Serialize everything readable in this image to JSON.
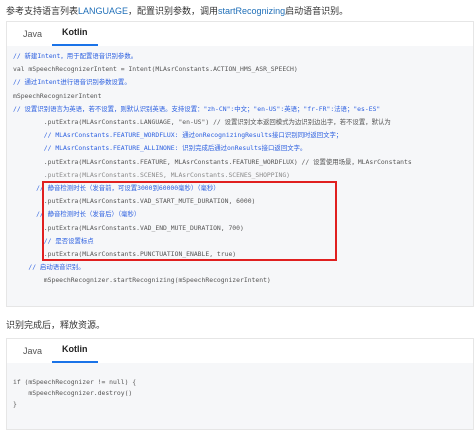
{
  "intro": {
    "text_before": "参考支持语言列表",
    "link1": "LANGUAGE",
    "text_mid": "，配置识别参数，调用",
    "link2": "startRecognizing",
    "text_after": "启动语音识别。"
  },
  "block1": {
    "tabs": [
      {
        "label": "Java",
        "active": false
      },
      {
        "label": "Kotlin",
        "active": true
      }
    ],
    "lines": [
      {
        "kind": "comment",
        "text": "// 新建Intent，用于配置语音识别参数。"
      },
      {
        "kind": "code",
        "text": "val mSpeechRecognizerIntent = Intent(MLAsrConstants.ACTION_HMS_ASR_SPEECH)"
      },
      {
        "kind": "comment",
        "text": "// 通过Intent进行语音识别参数设置。"
      },
      {
        "kind": "code",
        "text": "mSpeechRecognizerIntent"
      },
      {
        "kind": "comment",
        "text": "// 设置识别语言为英语，若不设置，则默认识别英语。支持设置：\"zh-CN\":中文；\"en-US\":英语；\"fr-FR\":法语；\"es-ES\""
      },
      {
        "kind": "code",
        "text": "        .putExtra(MLAsrConstants.LANGUAGE, \"en-US\") // 设置识别文本返回模式为边识别边出字，若不设置，默认为"
      },
      {
        "kind": "comment",
        "text": "        // MLAsrConstants.FEATURE_WORDFLUX: 通过onRecognizingResults接口识别同时返回文字；"
      },
      {
        "kind": "comment",
        "text": "        // MLAsrConstants.FEATURE_ALLINONE: 识别完成后通过onResults接口返回文字。"
      },
      {
        "kind": "code",
        "text": "        .putExtra(MLAsrConstants.FEATURE, MLAsrConstants.FEATURE_WORDFLUX) // 设置使用场景，MLAsrConstants"
      },
      {
        "kind": "dim",
        "text": "        .putExtra(MLAsrConstants.SCENES, MLAsrConstants.SCENES_SHOPPING)"
      },
      {
        "kind": "comment",
        "text": "      // 静音检测时长（发音前，可设置3000到60000毫秒）（毫秒）"
      },
      {
        "kind": "code",
        "text": "        .putExtra(MLAsrConstants.VAD_START_MUTE_DURATION, 6000)"
      },
      {
        "kind": "comment",
        "text": "      // 静音检测时长（发音后）（毫秒）"
      },
      {
        "kind": "code",
        "text": "        .putExtra(MLAsrConstants.VAD_END_MUTE_DURATION, 700)"
      },
      {
        "kind": "comment",
        "text": "        // 是否设置标点"
      },
      {
        "kind": "code",
        "text": "        .putExtra(MLAsrConstants.PUNCTUATION_ENABLE, true)"
      },
      {
        "kind": "comment",
        "text": "    // 启动语音识别。"
      },
      {
        "kind": "code",
        "text": "        mSpeechRecognizer.startRecognizing(mSpeechRecognizerIntent)"
      }
    ]
  },
  "separator_text": "识别完成后，释放资源。",
  "block2": {
    "tabs": [
      {
        "label": "Java",
        "active": false
      },
      {
        "label": "Kotlin",
        "active": true
      }
    ],
    "lines": [
      {
        "kind": "code",
        "text": "if (mSpeechRecognizer != null) {"
      },
      {
        "kind": "code",
        "text": "    mSpeechRecognizer.destroy()"
      },
      {
        "kind": "code",
        "text": "}"
      }
    ]
  },
  "colors": {
    "link": "#1f6fb8",
    "comment": "#2b5fe0",
    "tab_underline": "#1a73e8",
    "highlight_border": "#e02020",
    "code_bg": "#f6f7f9"
  }
}
